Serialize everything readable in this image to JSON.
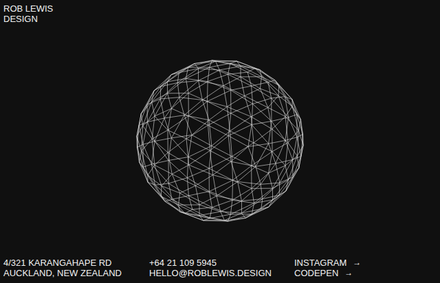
{
  "brand": {
    "lines": [
      "ROB LEWIS",
      "DESIGN"
    ]
  },
  "footer": {
    "address": [
      "4/321 KARANGAHAPE RD",
      "AUCKLAND, NEW ZEALAND"
    ],
    "contact": [
      "+64 21 109 5945",
      "HELLO@ROBLEWIS.DESIGN"
    ],
    "links": [
      {
        "label": "INSTAGRAM",
        "icon": "→"
      },
      {
        "label": "CODEPEN",
        "icon": "→"
      }
    ]
  }
}
